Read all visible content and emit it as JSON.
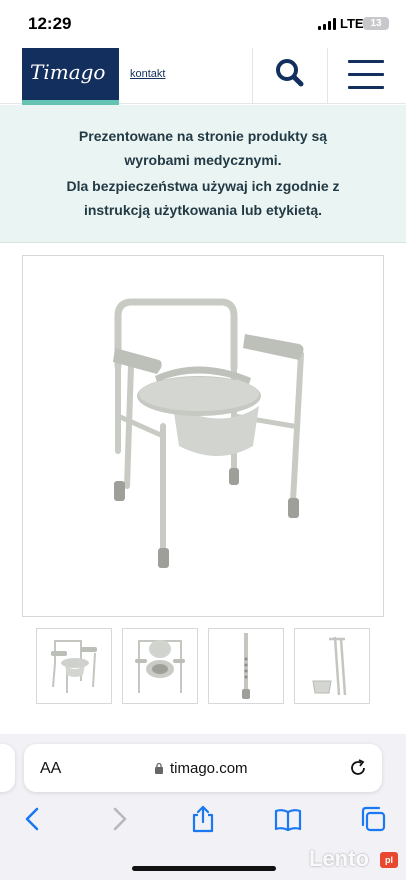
{
  "status_bar": {
    "time": "12:29",
    "network": "LTE",
    "battery": "13"
  },
  "header": {
    "logo_text": "Timago",
    "contact_link": "kontakt",
    "icons": {
      "search": "search-icon",
      "menu": "hamburger-menu-icon"
    },
    "colors": {
      "brand_navy": "#132f5e",
      "brand_teal": "#66c2b2"
    }
  },
  "notice": {
    "line1": "Prezentowane na stronie produkty są",
    "line2": "wyrobami medycznymi.",
    "line3": "Dla bezpieczeństwa używaj ich zgodnie z",
    "line4": "instrukcją użytkowania lub etykietą.",
    "background": "#eaf5f3"
  },
  "product": {
    "main_image": "commode-chair-photo",
    "thumbnails": [
      "commode-chair-front",
      "commode-chair-seat-open",
      "commode-leg-detail",
      "commode-folded-side"
    ]
  },
  "browser": {
    "text_size_label": "AA",
    "url": "timago.com",
    "icons": [
      "back-icon",
      "forward-icon",
      "share-icon",
      "bookmarks-icon",
      "tabs-icon"
    ]
  },
  "watermark": {
    "text": "Lento",
    "suffix": "pl"
  }
}
